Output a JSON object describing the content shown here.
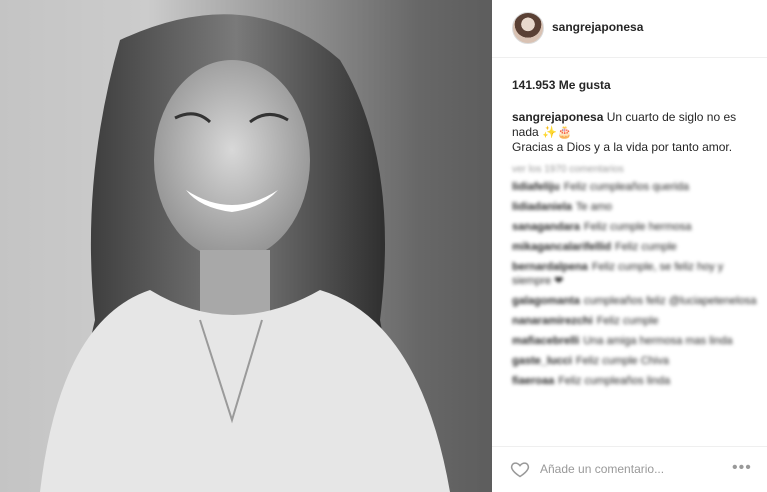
{
  "post": {
    "username": "sangrejaponesa",
    "likes_text": "141.953 Me gusta",
    "caption": {
      "username": "sangrejaponesa",
      "text_line1": "Un cuarto de siglo no es nada",
      "emojis": "✨🎂",
      "text_line2": "Gracias a Dios y a la vida por tanto amor."
    }
  },
  "comments": {
    "view_all": "ver los 1970 comentarios",
    "items": [
      {
        "user": "lidiafeliju",
        "text": "Feliz cumpleaños querida"
      },
      {
        "user": "lidiadaniela",
        "text": "Te amo"
      },
      {
        "user": "sanagandara",
        "text": "Feliz cumple hermosa"
      },
      {
        "user": "mikagancalarifellid",
        "text": "Feliz cumple"
      },
      {
        "user": "bernardalpena",
        "text": "Feliz cumple, se feliz hoy y siempre ❤"
      },
      {
        "user": "galagomanta",
        "text": "cumpleaños feliz @luciapetenelosa"
      },
      {
        "user": "nanaramirezchi",
        "text": "Feliz cumple"
      },
      {
        "user": "mafiacebrelli",
        "text": "Una amiga hermosa mas linda"
      },
      {
        "user": "gaste_lucci",
        "text": "Feliz cumple Chiva"
      },
      {
        "user": "fiaeroaa",
        "text": "Feliz cumpleaños linda"
      }
    ]
  },
  "footer": {
    "placeholder": "Añade un comentario...",
    "more_label": "•••"
  },
  "icons": {
    "heart": "heart-icon",
    "more": "more-options-icon"
  },
  "colors": {
    "username": "#262626",
    "muted": "#999999",
    "divider": "#efefef"
  }
}
